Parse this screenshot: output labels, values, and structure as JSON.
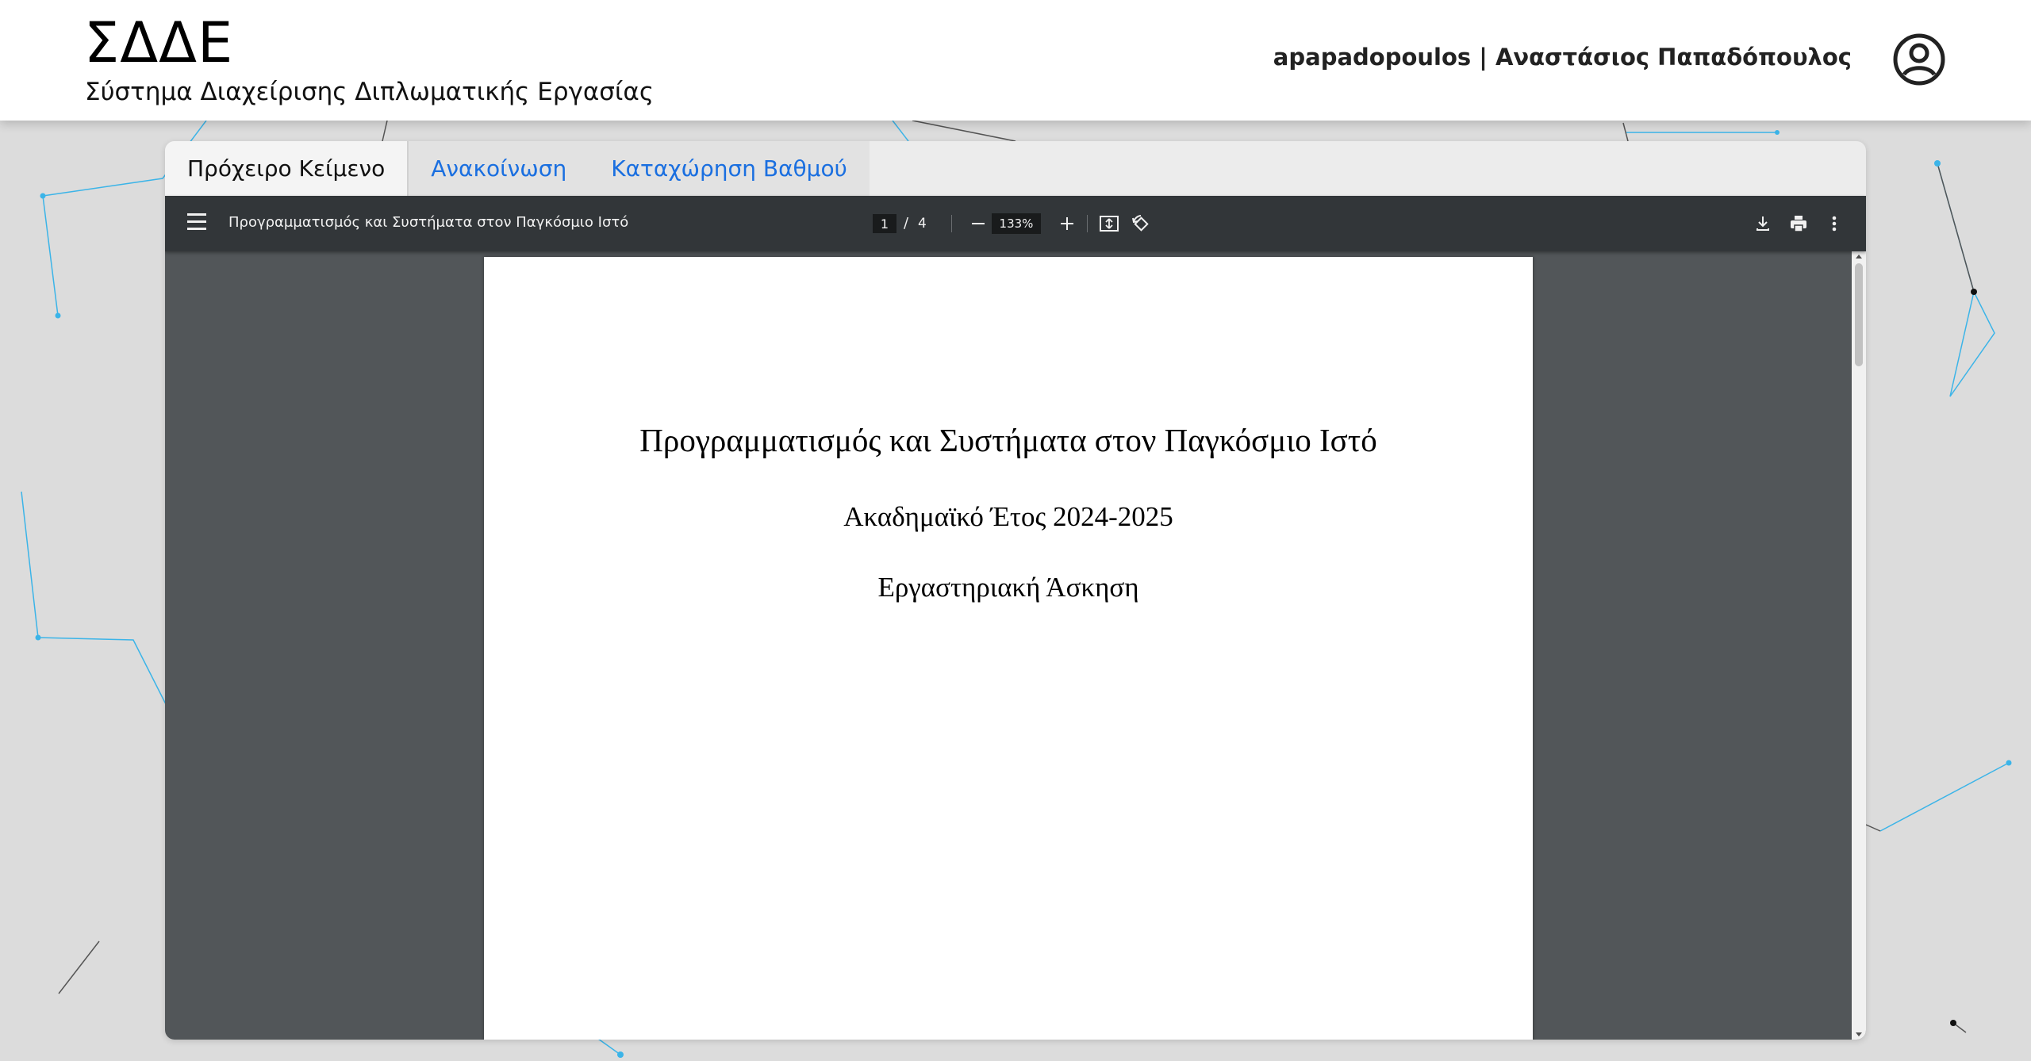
{
  "header": {
    "logo": "ΣΔΔΕ",
    "subtitle": "Σύστημα Διαχείρισης Διπλωματικής Εργασίας",
    "user_label": "apapadopoulos | Αναστάσιος Παπαδόπουλος",
    "user_icon": "account-circle-icon"
  },
  "tabs": [
    {
      "label": "Πρόχειρο Κείμενο",
      "active": true
    },
    {
      "label": "Ανακοίνωση",
      "active": false
    },
    {
      "label": "Καταχώρηση Βαθμού",
      "active": false
    }
  ],
  "pdf_viewer": {
    "document_title": "Προγραμματισμός και Συστήματα στον Παγκόσμιο Ιστό",
    "current_page": "1",
    "page_separator": "/",
    "total_pages": "4",
    "zoom": "133%",
    "icons": [
      "menu-icon",
      "zoom-out-icon",
      "zoom-in-icon",
      "fit-page-icon",
      "rotate-icon",
      "download-icon",
      "print-icon",
      "more-vert-icon"
    ]
  },
  "pdf_page": {
    "title": "Προγραμματισμός και Συστήματα στον Παγκόσμιο Ιστό",
    "academic_year": "Ακαδημαϊκό Έτος 2024-2025",
    "exercise": "Εργαστηριακή Άσκηση"
  },
  "colors": {
    "accent": "#1a6fe0",
    "toolbar": "#323639",
    "viewer_bg": "#525659",
    "bg_line_blue": "#3bb4e8"
  }
}
